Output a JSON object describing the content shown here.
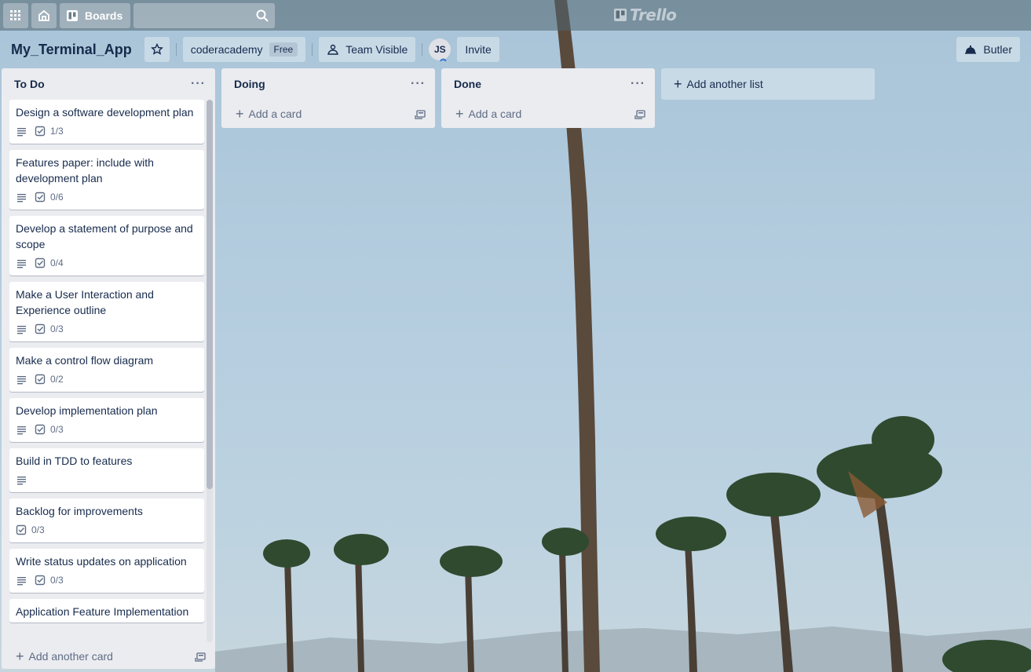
{
  "header": {
    "boards_label": "Boards",
    "search_placeholder": "",
    "logo_text": "Trello"
  },
  "board": {
    "title": "My_Terminal_App",
    "team_name": "coderacademy",
    "plan_badge": "Free",
    "visibility": "Team Visible",
    "member_initials": "JS",
    "invite_label": "Invite",
    "butler_label": "Butler"
  },
  "lists": [
    {
      "title": "To Do",
      "menu": "···",
      "add_label": "Add another card",
      "cards": [
        {
          "title": "Design a software development plan",
          "has_description": true,
          "checklist": "1/3"
        },
        {
          "title": "Features paper: include with development plan",
          "has_description": true,
          "checklist": "0/6"
        },
        {
          "title": "Develop a statement of purpose and scope",
          "has_description": true,
          "checklist": "0/4"
        },
        {
          "title": "Make a User Interaction and Experience outline",
          "has_description": true,
          "checklist": "0/3"
        },
        {
          "title": "Make a control flow diagram",
          "has_description": true,
          "checklist": "0/2"
        },
        {
          "title": "Develop implementation plan",
          "has_description": true,
          "checklist": "0/3"
        },
        {
          "title": "Build in TDD to features",
          "has_description": true,
          "checklist": ""
        },
        {
          "title": "Backlog for improvements",
          "has_description": false,
          "checklist": "0/3"
        },
        {
          "title": "Write status updates on application",
          "has_description": true,
          "checklist": "0/3"
        },
        {
          "title": "Application Feature Implementation",
          "has_description": false,
          "checklist": ""
        }
      ]
    },
    {
      "title": "Doing",
      "menu": "···",
      "add_label": "Add a card",
      "cards": []
    },
    {
      "title": "Done",
      "menu": "···",
      "add_label": "Add a card",
      "cards": []
    }
  ],
  "add_list_label": "Add another list",
  "icons": {
    "apps": "apps-grid-icon",
    "home": "home-icon",
    "boards": "boards-icon",
    "search": "search-icon",
    "star": "star-icon",
    "team": "team-icon",
    "butler": "butler-icon",
    "description": "description-icon",
    "checklist": "checklist-icon",
    "template": "card-template-icon"
  },
  "colors": {
    "list_bg": "#ebecf0",
    "text": "#172b4d",
    "muted": "#5e6c84"
  }
}
